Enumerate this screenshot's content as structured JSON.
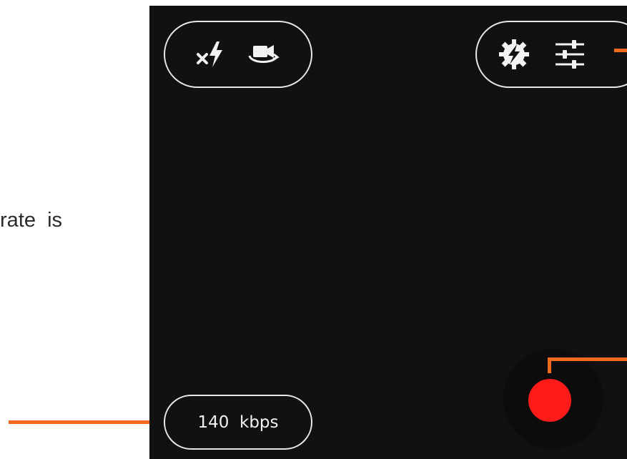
{
  "annotation": {
    "side_text": "rate  is"
  },
  "camera": {
    "top_left_controls": [
      {
        "icon": "flash-off-icon"
      },
      {
        "icon": "switch-camera-icon"
      }
    ],
    "top_right_controls": [
      {
        "icon": "auto-settings-icon"
      },
      {
        "icon": "sliders-icon"
      }
    ],
    "bitrate": {
      "label": "140  kbps"
    },
    "record_button": {
      "icon": "record-icon"
    }
  },
  "colors": {
    "accent": "#f26a1b",
    "record": "#ff1a1a",
    "background": "#111111"
  }
}
